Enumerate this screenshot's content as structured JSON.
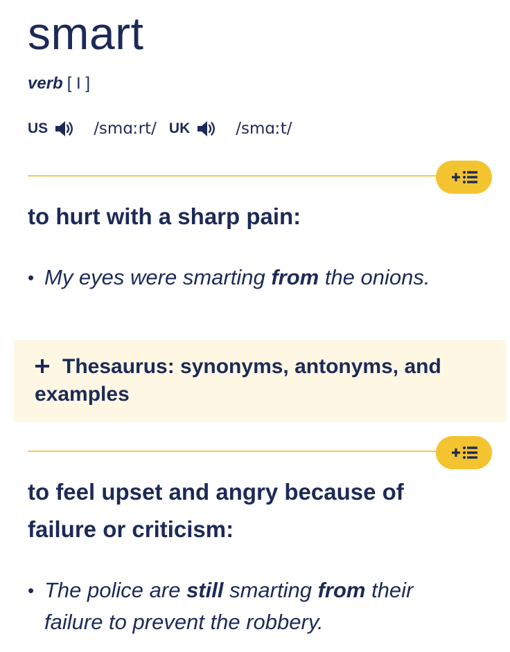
{
  "entry": {
    "headword": "smart",
    "part_of_speech": "verb",
    "grammar": "[ I ]",
    "pronunciations": [
      {
        "region": "US",
        "ipa": "/smɑːrt/",
        "icon": "speaker-icon"
      },
      {
        "region": "UK",
        "ipa": "/smɑːt/",
        "icon": "speaker-icon"
      }
    ]
  },
  "senses": [
    {
      "definition": "to hurt with a sharp pain:",
      "add_button_icon": "plus-list-icon",
      "example": {
        "bullet": "•",
        "parts": [
          "My eyes were smarting ",
          "from",
          " the onions."
        ]
      }
    },
    {
      "definition": "to feel upset and angry because of failure or criticism:",
      "add_button_icon": "plus-list-icon",
      "example": {
        "bullet": "•",
        "parts": [
          "The police are ",
          "still",
          " smarting ",
          "from",
          " their failure to prevent the robbery."
        ]
      }
    }
  ],
  "thesaurus": {
    "label": "Thesaurus: synonyms, antonyms, and examples",
    "icon": "plus-icon"
  },
  "colors": {
    "text": "#1d2a57",
    "accent": "#f4c430",
    "divider": "#f2c94c",
    "thesaurus_bg": "#fdf7e4"
  }
}
